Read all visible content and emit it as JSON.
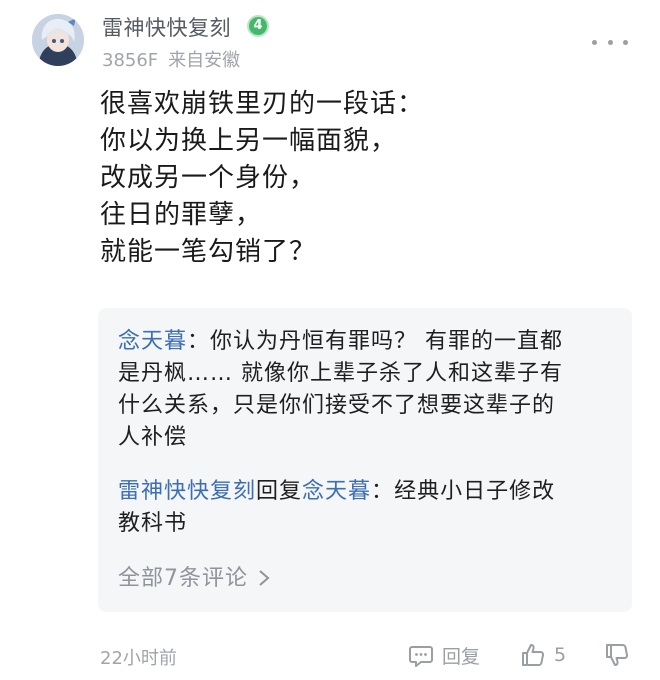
{
  "comment": {
    "username": "雷神快快复刻",
    "level": "4",
    "floor": "3856F",
    "location": "来自安徽",
    "lines": [
      "很喜欢崩铁里刃的一段话：",
      "你以为换上另一幅面貌，",
      "改成另一个身份，",
      "往日的罪孽，",
      "就能一笔勾销了？"
    ],
    "time": "22小时前",
    "reply_label": "回复",
    "like_count": "5"
  },
  "replies": [
    {
      "author": "念天暮",
      "separator": "：",
      "lines": [
        "你认为丹恒有罪吗？ 有罪的一直都",
        "是丹枫…… 就像你上辈子杀了人和这辈子有",
        "什么关系，只是你们接受不了想要这辈子的",
        "人补偿"
      ]
    },
    {
      "author": "雷神快快复刻",
      "reply_word": "回复",
      "target": "念天暮",
      "separator": "：",
      "first_text": "经典小日子修改",
      "lines": [
        "教科书"
      ]
    }
  ],
  "see_all": "全部7条评论",
  "icons": {
    "more": "more-dots-icon",
    "reply": "comment-bubble-icon",
    "like": "thumbs-up-icon",
    "dislike": "thumbs-down-icon",
    "see_all_chevron": "chevron-right-icon"
  },
  "colors": {
    "link": "#3c6eb4",
    "level_badge": "#46b86a",
    "reply_bg": "#f5f6f8"
  }
}
